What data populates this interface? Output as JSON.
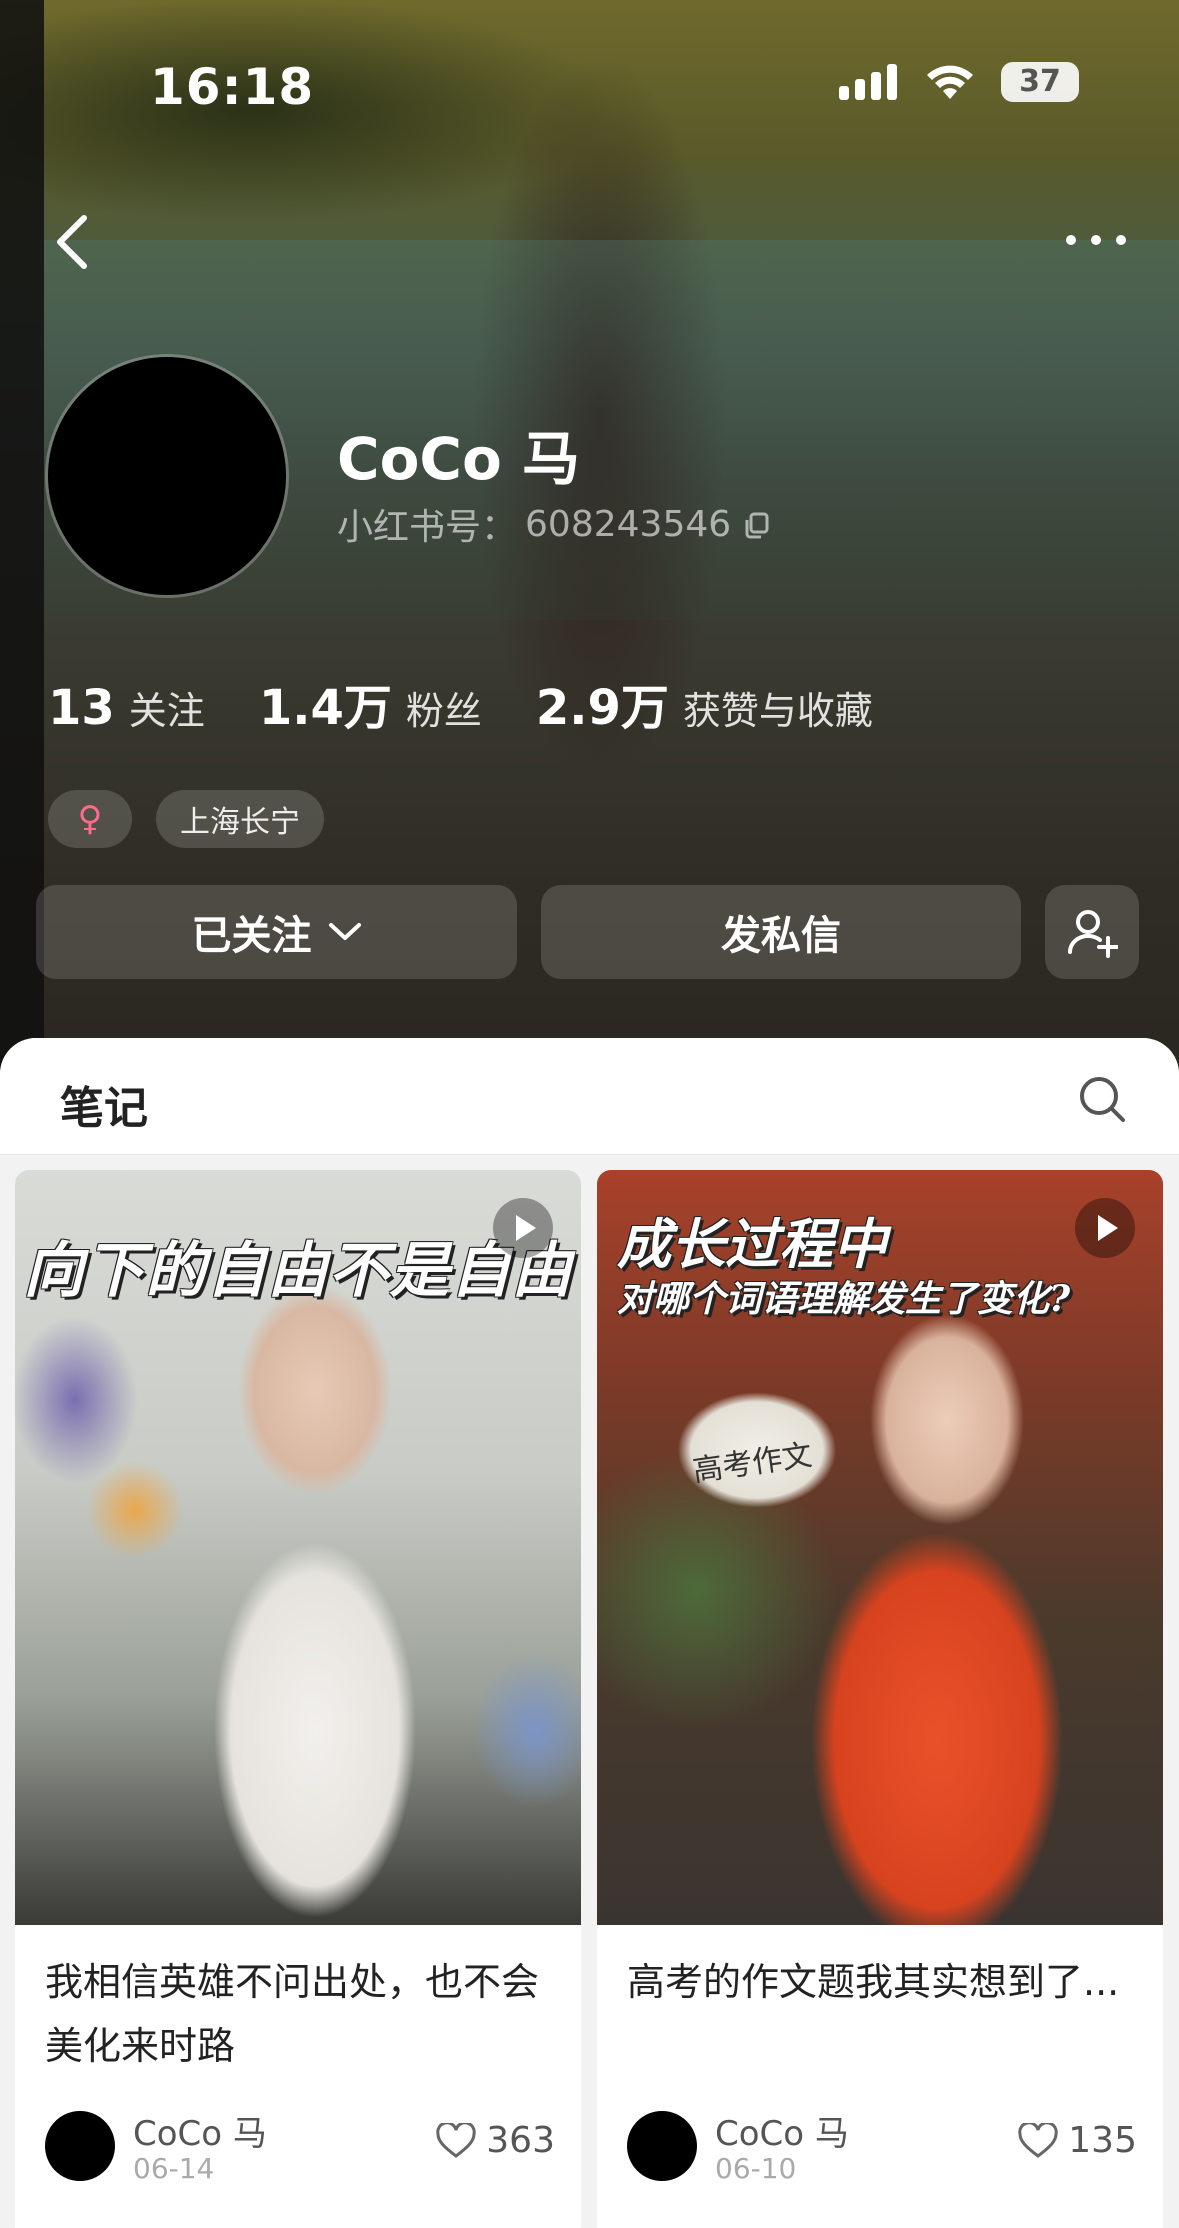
{
  "status_bar": {
    "time": "16:18",
    "battery": "37"
  },
  "profile": {
    "name": "CoCo 马",
    "id_label": "小红书号：",
    "id_value": "608243546",
    "stats": [
      {
        "num": "13",
        "label": "关注"
      },
      {
        "num": "1.4万",
        "label": "粉丝"
      },
      {
        "num": "2.9万",
        "label": "获赞与收藏"
      }
    ],
    "tags": {
      "gender_symbol": "♀",
      "location": "上海长宁"
    },
    "buttons": {
      "follow": "已关注",
      "message": "发私信"
    }
  },
  "notes_section": {
    "title": "笔记",
    "cards": [
      {
        "cover_text": "向下的自由不是自由",
        "title": "我相信英雄不问出处，也不会美化来时路",
        "author": "CoCo 马",
        "date": "06-14",
        "likes": "363"
      },
      {
        "cover_text_1": "成长过程中",
        "cover_text_2": "对哪个词语理解发生了变化?",
        "cover_label": "高考作文",
        "title": "高考的作文题我其实想到了...",
        "author": "CoCo 马",
        "date": "06-10",
        "likes": "135"
      }
    ]
  },
  "colors": {
    "accent_pink": "#ff6b8a",
    "sheet_bg": "#f2f2f2"
  }
}
